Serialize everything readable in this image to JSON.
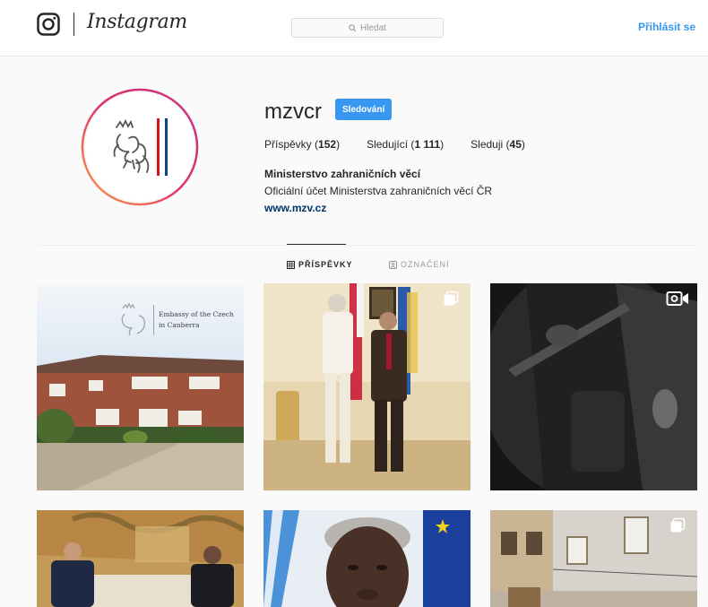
{
  "nav": {
    "wordmark": "Instagram",
    "search_placeholder": "Hledat",
    "login_label": "Přihlásit se"
  },
  "profile": {
    "username": "mzvcr",
    "follow_label": "Sledování",
    "posts_label": "Příspěvky",
    "posts_count": "152",
    "followers_label": "Sledující",
    "followers_count": "1 111",
    "following_label": "Sleduji",
    "following_count": "45",
    "full_name": "Ministerstvo zahraničních věcí",
    "bio": "Oficiální účet Ministerstva zahraničních věcí ČR",
    "website": "www.mzv.cz"
  },
  "tabs": [
    {
      "label": "PŘÍSPĚVKY",
      "icon": "grid-icon",
      "active": true
    },
    {
      "label": "OZNAČENÍ",
      "icon": "tagged-icon",
      "active": false
    }
  ],
  "posts": [
    {
      "caption_line1": "Embassy of the Czech",
      "caption_line2": "in Canberra",
      "badge": "none"
    },
    {
      "badge": "carousel-icon"
    },
    {
      "badge": "video-icon"
    },
    {
      "badge": "none"
    },
    {
      "badge": "none"
    },
    {
      "badge": "carousel-icon"
    }
  ],
  "colors": {
    "accent": "#3897f0",
    "link": "#003569",
    "avatar_ring_start": "#f9a54b",
    "avatar_ring_end": "#c13584"
  }
}
